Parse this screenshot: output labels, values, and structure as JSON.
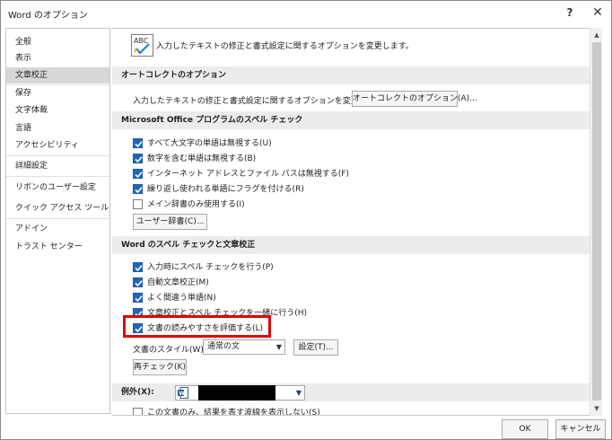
{
  "window": {
    "title": "Word のオプション",
    "help_label": "?",
    "close_label": "✕"
  },
  "sidebar": {
    "items": [
      {
        "label": "全般"
      },
      {
        "label": "表示"
      },
      {
        "label": "文章校正",
        "selected": true
      },
      {
        "label": "保存"
      },
      {
        "label": "文字体裁"
      },
      {
        "label": "言語"
      },
      {
        "label": "アクセシビリティ"
      },
      {
        "label": "詳細設定"
      },
      {
        "label": "リボンのユーザー設定"
      },
      {
        "label": "クイック アクセス ツール バー"
      },
      {
        "label": "アドイン"
      },
      {
        "label": "トラスト センター"
      }
    ]
  },
  "main": {
    "intro_text": "入力したテキストの修正と書式設定に関するオプションを変更します。",
    "autocorrect": {
      "header": "オートコレクトのオプション",
      "description": "入力したテキストの修正と書式設定に関するオプションを変更します。",
      "button_label": "オートコレクトのオプション(A)..."
    },
    "office_spelling": {
      "header": "Microsoft Office プログラムのスペル チェック",
      "options": [
        {
          "label": "すべて大文字の単語は無視する(U)",
          "checked": true
        },
        {
          "label": "数字を含む単語は無視する(B)",
          "checked": true
        },
        {
          "label": "インターネット アドレスとファイル パスは無視する(F)",
          "checked": true
        },
        {
          "label": "繰り返し使われる単語にフラグを付ける(R)",
          "checked": true
        },
        {
          "label": "メイン辞書のみ使用する(I)",
          "checked": false
        }
      ],
      "dictionary_button_label": "ユーザー辞書(C)..."
    },
    "word_spelling": {
      "header": "Word のスペル チェックと文章校正",
      "options": [
        {
          "label": "入力時にスペル チェックを行う(P)",
          "checked": true
        },
        {
          "label": "自動文章校正(M)",
          "checked": true
        },
        {
          "label": "よく間違う単語(N)",
          "checked": true
        },
        {
          "label": "文章校正とスペル チェックを一緒に行う(H)",
          "checked": true
        },
        {
          "label": "文書の読みやすさを評価する(L)",
          "checked": true
        }
      ],
      "style_label": "文書のスタイル(W):",
      "style_value": "通常の文",
      "settings_button_label": "設定(T)...",
      "recheck_button_label": "再チェック(K)"
    },
    "exceptions": {
      "label": "例外(X):",
      "option_label": "この文書のみ、結果を表す波線を表示しない(S)",
      "option_checked": false
    }
  },
  "footer": {
    "ok_label": "OK",
    "cancel_label": "キャンセル"
  },
  "colors": {
    "checkbox_blue": "#1f66b8",
    "highlight_red": "#e00000",
    "section_header_bg": "#ececec",
    "selected_nav_bg": "#d7d7d7"
  }
}
